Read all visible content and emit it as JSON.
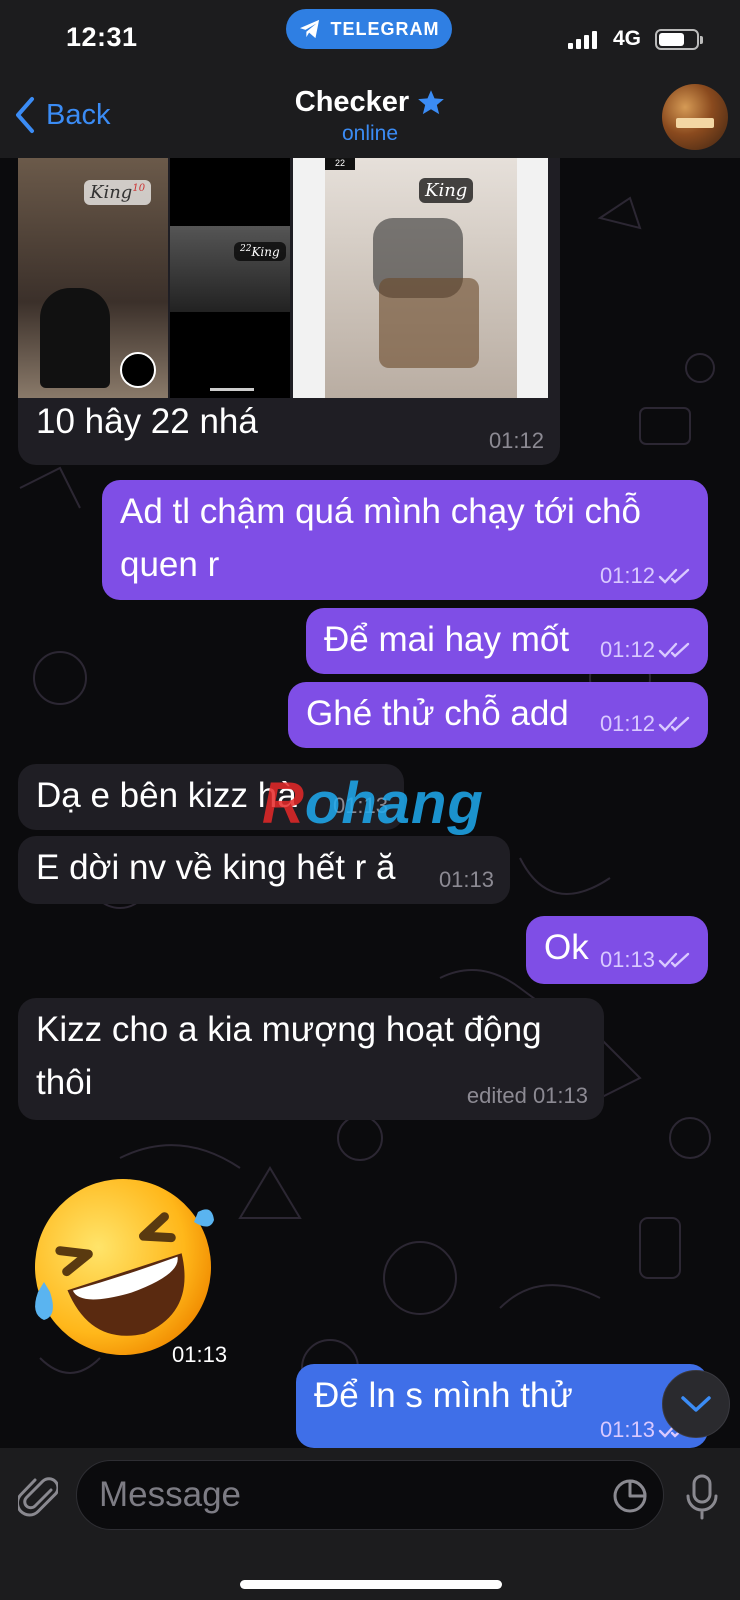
{
  "status_bar": {
    "time": "12:31",
    "app_pill": "TELEGRAM",
    "network": "4G"
  },
  "nav": {
    "back_label": "Back",
    "chat_title": "Checker",
    "chat_status": "online",
    "title_badge_icon": "star-icon"
  },
  "album": {
    "caption": "10 hây 22 nhá",
    "time": "01:12",
    "photo_labels": [
      "King",
      "King",
      "King"
    ],
    "photo_numbers": [
      "10",
      "22",
      "22"
    ]
  },
  "messages": [
    {
      "dir": "out",
      "text": "Ad tl chậm quá mình chạy tới chỗ quen r",
      "time": "01:12",
      "read": true
    },
    {
      "dir": "out",
      "text": "Để mai hay mốt",
      "time": "01:12",
      "read": true
    },
    {
      "dir": "out",
      "text": "Ghé thử chỗ add",
      "time": "01:12",
      "read": true
    },
    {
      "dir": "in",
      "text": "Dạ e bên kizz hà",
      "time": "01:13"
    },
    {
      "dir": "in",
      "text": "E dời nv về king hết r ă",
      "time": "01:13"
    },
    {
      "dir": "out",
      "text": "Ok",
      "time": "01:13",
      "read": true
    },
    {
      "dir": "in",
      "text": "Kizz cho a kia mượng hoạt động thôi",
      "time": "edited 01:13"
    },
    {
      "dir": "out",
      "text": "Để ln s mình thử",
      "time": "01:13",
      "read": true
    }
  ],
  "emoji_message": {
    "emoji": "rolling-on-floor-laughing",
    "time": "01:13"
  },
  "watermark": {
    "prefix": "R",
    "rest": "ohang"
  },
  "input": {
    "placeholder": "Message"
  },
  "colors": {
    "accent": "#3b8cf5",
    "outgoing_bubble": "#7f4ee6",
    "incoming_bubble": "#1f1e24",
    "bar_background": "#1c1c1e"
  }
}
